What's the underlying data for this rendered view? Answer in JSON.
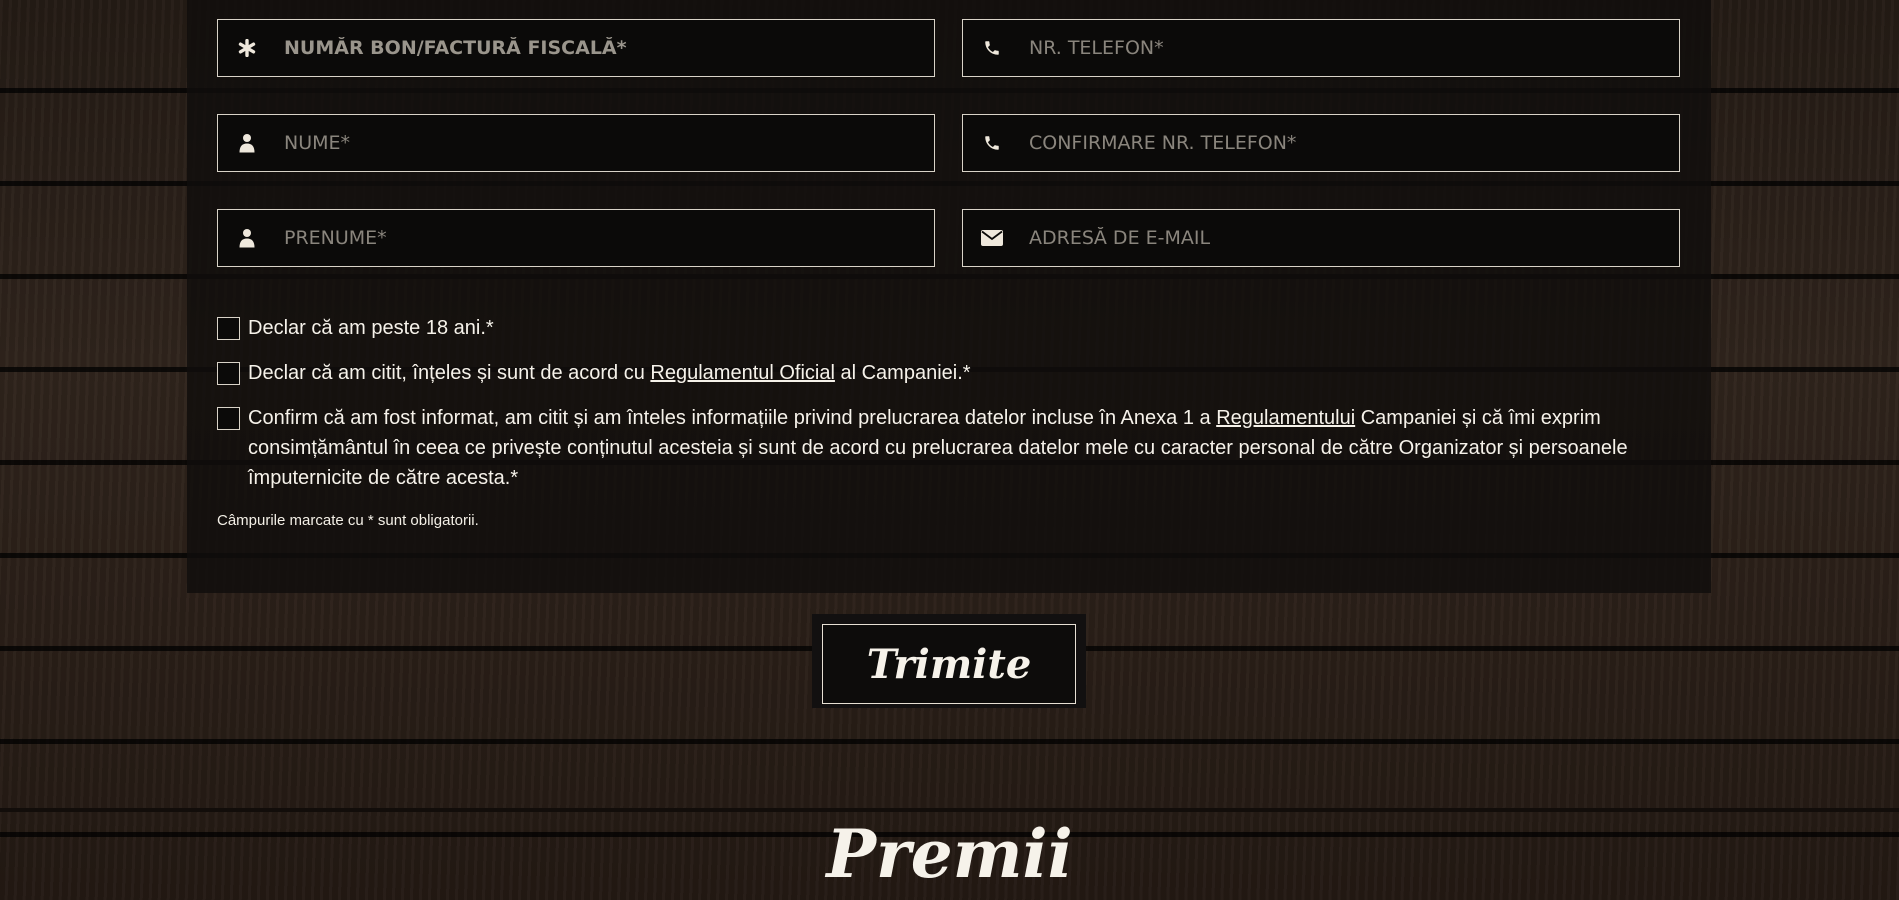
{
  "form": {
    "fields": [
      {
        "placeholder": "NUMĂR BON/FACTURĂ FISCALĂ*",
        "icon": "asterisk-icon"
      },
      {
        "placeholder": "NR. TELEFON*",
        "icon": "phone-icon"
      },
      {
        "placeholder": "NUME*",
        "icon": "user-icon"
      },
      {
        "placeholder": "CONFIRMARE NR. TELEFON*",
        "icon": "phone-icon"
      },
      {
        "placeholder": "PRENUME*",
        "icon": "user-icon"
      },
      {
        "placeholder": "ADRESĂ DE E-MAIL",
        "icon": "envelope-icon"
      }
    ],
    "checkboxes": {
      "age": {
        "text": "Declar că am peste 18 ani.*"
      },
      "rules": {
        "before": "Declar că am citit, înțeles și sunt de acord cu ",
        "link": "Regulamentul Oficial",
        "after": " al Campaniei.*"
      },
      "consent": {
        "before": "Confirm că am fost informat, am citit și am înteles informațiile privind prelucrarea datelor incluse în Anexa 1 a ",
        "link": "Regulamentului",
        "after": " Campaniei și că îmi exprim consimțământul în ceea ce privește conținutul acesteia și sunt de acord cu prelucrarea datelor mele cu caracter personal de către Organizator și persoanele împuternicite de către acesta.*"
      }
    },
    "required_note": "Câmpurile marcate cu * sunt obligatorii.",
    "submit_label": "Trimite"
  },
  "section": {
    "title": "Premii"
  }
}
